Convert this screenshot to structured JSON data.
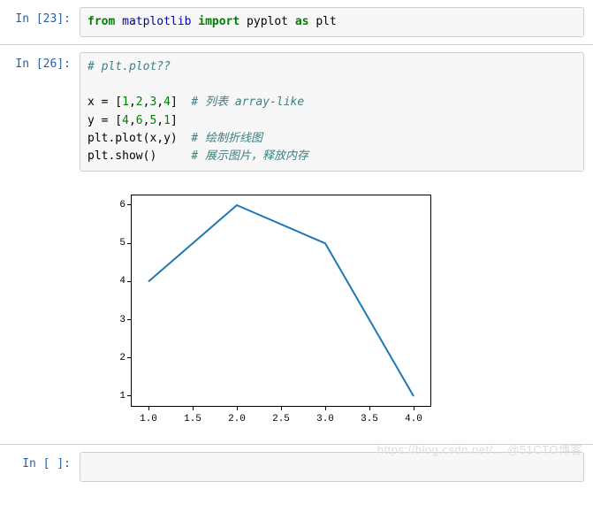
{
  "cells": {
    "c1": {
      "prompt": "In  [23]:",
      "tokens": {
        "kw_from": "from",
        "mod": "matplotlib",
        "kw_import": "import",
        "sub": "pyplot",
        "kw_as": "as",
        "alias": "plt"
      }
    },
    "c2": {
      "prompt": "In  [26]:",
      "line1_comment": "# plt.plot??",
      "line3_pre": "x = [",
      "n1": "1",
      "comma": ",",
      "n2": "2",
      "n3": "3",
      "n4": "4",
      "line3_post": "]  ",
      "line3_comment": "# 列表 array-like",
      "line4_pre": "y = [",
      "m1": "4",
      "m2": "6",
      "m3": "5",
      "m4": "1",
      "line4_post": "]",
      "line5_code": "plt.plot(x,y)  ",
      "line5_comment": "# 绘制折线图",
      "line6_code": "plt.show()     ",
      "line6_comment": "# 展示图片，释放内存"
    },
    "c3": {
      "prompt": "In  [ ]:"
    }
  },
  "chart_data": {
    "type": "line",
    "x": [
      1,
      2,
      3,
      4
    ],
    "y": [
      4,
      6,
      5,
      1
    ],
    "xlabel": "",
    "ylabel": "",
    "title": "",
    "xlim": [
      1.0,
      4.0
    ],
    "ylim": [
      1,
      6
    ],
    "xticks": [
      1.0,
      1.5,
      2.0,
      2.5,
      3.0,
      3.5,
      4.0
    ],
    "yticks": [
      1,
      2,
      3,
      4,
      5,
      6
    ],
    "xtick_labels": [
      "1.0",
      "1.5",
      "2.0",
      "2.5",
      "3.0",
      "3.5",
      "4.0"
    ],
    "ytick_labels": [
      "1",
      "2",
      "3",
      "4",
      "5",
      "6"
    ],
    "line_color": "#1f77b4"
  },
  "watermark": "https://blog.csdn.net/... @51CTO博客"
}
